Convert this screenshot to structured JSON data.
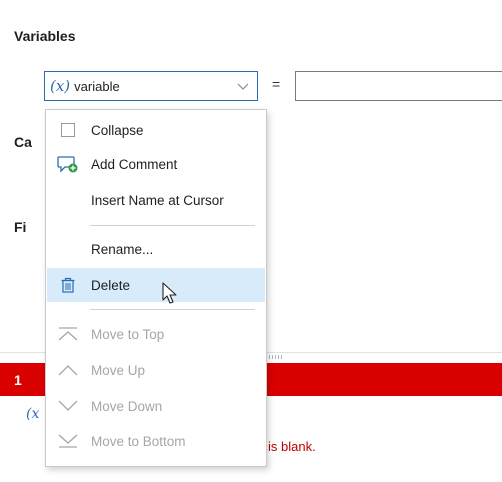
{
  "panel": {
    "variables_title": "Variables",
    "section2_partial": "Ca",
    "section3_partial": "Fi",
    "equals_sign": "=",
    "variable_select": {
      "icon": "fx-icon",
      "icon_text": "(x)",
      "value": "variable"
    },
    "value_input": {
      "value": ""
    }
  },
  "validation": {
    "bar_text_partial": "1",
    "bar_color": "#d90000",
    "row_icon_text": "(x",
    "message_partial": "is blank."
  },
  "context_menu": {
    "items": [
      {
        "key": "collapse",
        "label": "Collapse",
        "icon": "checkbox-icon",
        "enabled": true,
        "highlighted": false
      },
      {
        "key": "add-comment",
        "label": "Add Comment",
        "icon": "add-comment-icon",
        "enabled": true,
        "highlighted": false
      },
      {
        "key": "insert-name",
        "label": "Insert Name at Cursor",
        "icon": "",
        "enabled": true,
        "highlighted": false
      },
      {
        "key": "rename",
        "label": "Rename...",
        "icon": "",
        "enabled": true,
        "highlighted": false
      },
      {
        "key": "delete",
        "label": "Delete",
        "icon": "trash-icon",
        "enabled": true,
        "highlighted": true
      },
      {
        "key": "move-top",
        "label": "Move to Top",
        "icon": "move-to-top-icon",
        "enabled": false,
        "highlighted": false
      },
      {
        "key": "move-up",
        "label": "Move Up",
        "icon": "move-up-icon",
        "enabled": false,
        "highlighted": false
      },
      {
        "key": "move-down",
        "label": "Move Down",
        "icon": "move-down-icon",
        "enabled": false,
        "highlighted": false
      },
      {
        "key": "move-bottom",
        "label": "Move to Bottom",
        "icon": "move-to-bottom-icon",
        "enabled": false,
        "highlighted": false
      }
    ]
  },
  "colors": {
    "accent": "#2b6cb0",
    "highlight": "#d7ebfa",
    "disabled_text": "#a6a6a6",
    "error_text": "#c00000"
  }
}
